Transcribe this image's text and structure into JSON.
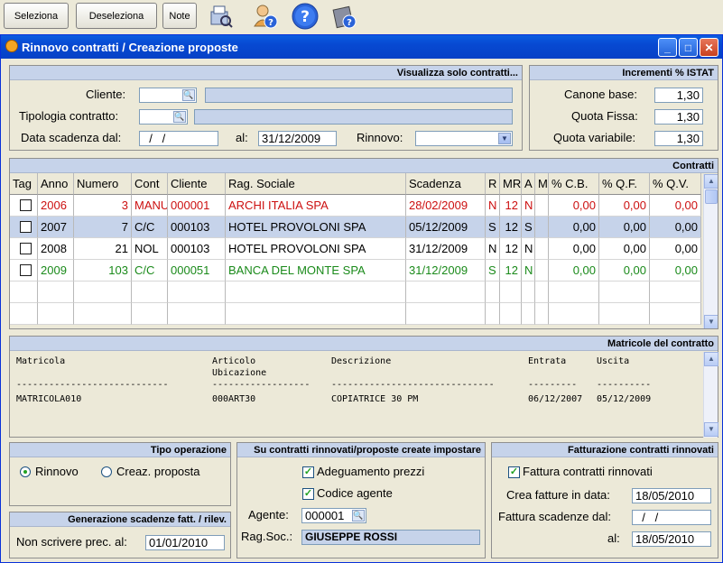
{
  "toolbar": {
    "seleziona": "Seleziona",
    "deseleziona": "Deseleziona",
    "note": "Note"
  },
  "window": {
    "title": "Rinnovo contratti / Creazione proposte"
  },
  "filter": {
    "header": "Visualizza solo contratti...",
    "cliente_label": "Cliente:",
    "cliente_code": "",
    "cliente_name": "",
    "tipologia_label": "Tipologia contratto:",
    "tipologia_code": "",
    "tipologia_desc": "",
    "data_label": "Data scadenza dal:",
    "data_dal": "  /   /",
    "al_label": "al:",
    "data_al": "31/12/2009",
    "rinnovo_label": "Rinnovo:",
    "rinnovo_value": ""
  },
  "istat": {
    "header": "Incrementi % ISTAT",
    "canone_label": "Canone base:",
    "canone_value": "1,30",
    "fissa_label": "Quota Fissa:",
    "fissa_value": "1,30",
    "variabile_label": "Quota variabile:",
    "variabile_value": "1,30"
  },
  "contratti": {
    "header": "Contratti",
    "columns": [
      "Tag",
      "Anno",
      "Numero",
      "Cont",
      "Cliente",
      "Rag. Sociale",
      "Scadenza",
      "R",
      "MR",
      "A",
      "M",
      "% C.B.",
      "% Q.F.",
      "% Q.V."
    ],
    "rows": [
      {
        "anno": "2006",
        "numero": "3",
        "cont": "MANU",
        "cliente": "000001",
        "rag": "ARCHI ITALIA SPA",
        "scadenza": "28/02/2009",
        "r": "N",
        "mr": "12",
        "a": "N",
        "m": "",
        "cb": "0,00",
        "qf": "0,00",
        "qv": "0,00"
      },
      {
        "anno": "2007",
        "numero": "7",
        "cont": "C/C",
        "cliente": "000103",
        "rag": "HOTEL PROVOLONI SPA",
        "scadenza": "05/12/2009",
        "r": "S",
        "mr": "12",
        "a": "S",
        "m": "",
        "cb": "0,00",
        "qf": "0,00",
        "qv": "0,00"
      },
      {
        "anno": "2008",
        "numero": "21",
        "cont": "NOL",
        "cliente": "000103",
        "rag": "HOTEL PROVOLONI SPA",
        "scadenza": "31/12/2009",
        "r": "N",
        "mr": "12",
        "a": "N",
        "m": "",
        "cb": "0,00",
        "qf": "0,00",
        "qv": "0,00"
      },
      {
        "anno": "2009",
        "numero": "103",
        "cont": "C/C",
        "cliente": "000051",
        "rag": "BANCA DEL MONTE SPA",
        "scadenza": "31/12/2009",
        "r": "S",
        "mr": "12",
        "a": "N",
        "m": "",
        "cb": "0,00",
        "qf": "0,00",
        "qv": "0,00"
      }
    ]
  },
  "matricole": {
    "header": "Matricole del contratto",
    "h_matricola": "Matricola",
    "h_articolo": "Articolo",
    "h_ubicazione": "Ubicazione",
    "h_descrizione": "Descrizione",
    "h_entrata": "Entrata",
    "h_uscita": "Uscita",
    "sep1": "----------------------------",
    "sep2": "------------------",
    "sep3": "------------------------------",
    "sep4": "---------",
    "sep5": "----------",
    "row_matricola": "MATRICOLA010",
    "row_articolo": "000ART30",
    "row_descrizione": "COPIATRICE 30 PM",
    "row_entrata": "06/12/2007",
    "row_uscita": "05/12/2009"
  },
  "tipo_operazione": {
    "header": "Tipo operazione",
    "rinnovo": "Rinnovo",
    "proposta": "Creaz. proposta"
  },
  "generazione": {
    "header": "Generazione scadenze fatt. / rilev.",
    "label": "Non scrivere prec. al:",
    "value": "01/01/2010"
  },
  "impostare": {
    "header": "Su contratti rinnovati/proposte create impostare",
    "adeguamento": "Adeguamento prezzi",
    "codice_agente": "Codice agente",
    "agente_label": "Agente:",
    "agente_value": "000001",
    "ragsoc_label": "Rag.Soc.:",
    "ragsoc_value": "GIUSEPPE ROSSI"
  },
  "fatturazione": {
    "header": "Fatturazione contratti rinnovati",
    "fattura_check": "Fattura contratti rinnovati",
    "crea_label": "Crea fatture in data:",
    "crea_value": "18/05/2010",
    "scad_label": "Fattura scadenze dal:",
    "scad_value": "  /   /",
    "al_label": "al:",
    "al_value": "18/05/2010"
  },
  "colors": {
    "red": "#cc1010",
    "green": "#1a8a1a",
    "selected": "#c6d3ea",
    "title_blue": "#0749d2"
  }
}
